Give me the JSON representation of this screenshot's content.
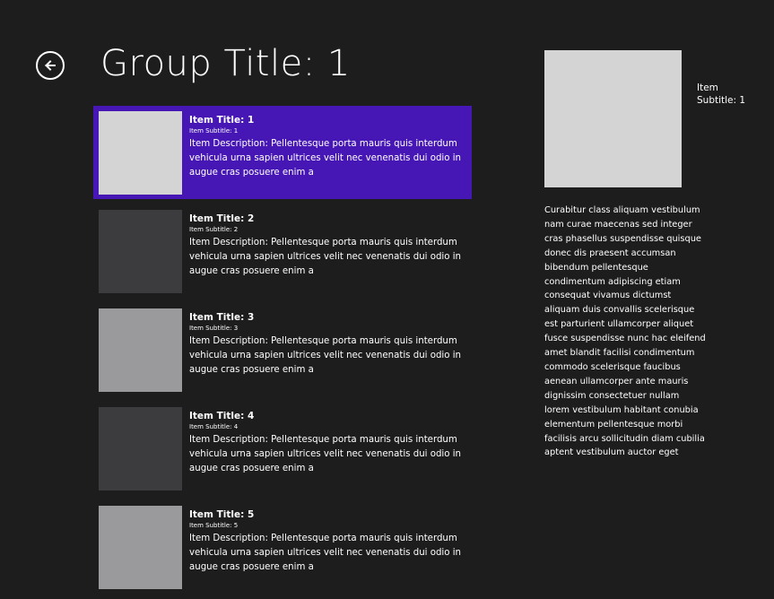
{
  "header": {
    "title": "Group Title: 1"
  },
  "items": [
    {
      "title": "Item Title: 1",
      "subtitle": "Item Subtitle: 1",
      "description": "Item Description: Pellentesque porta mauris quis interdum vehicula urna sapien ultrices velit nec venenatis dui odio in augue cras posuere enim a",
      "selected": true,
      "thumb_color": "#d4d4d4"
    },
    {
      "title": "Item Title: 2",
      "subtitle": "Item Subtitle: 2",
      "description": "Item Description: Pellentesque porta mauris quis interdum vehicula urna sapien ultrices velit nec venenatis dui odio in augue cras posuere enim a",
      "selected": false,
      "thumb_color": "#3c3c3e"
    },
    {
      "title": "Item Title: 3",
      "subtitle": "Item Subtitle: 3",
      "description": "Item Description: Pellentesque porta mauris quis interdum vehicula urna sapien ultrices velit nec venenatis dui odio in augue cras posuere enim a",
      "selected": false,
      "thumb_color": "#9a9a9c"
    },
    {
      "title": "Item Title: 4",
      "subtitle": "Item Subtitle: 4",
      "description": "Item Description: Pellentesque porta mauris quis interdum vehicula urna sapien ultrices velit nec venenatis dui odio in augue cras posuere enim a",
      "selected": false,
      "thumb_color": "#3c3c3e"
    },
    {
      "title": "Item Title: 5",
      "subtitle": "Item Subtitle: 5",
      "description": "Item Description: Pellentesque porta mauris quis interdum vehicula urna sapien ultrices velit nec venenatis dui odio in augue cras posuere enim a",
      "selected": false,
      "thumb_color": "#9a9a9c"
    }
  ],
  "detail": {
    "subtitle": "Item Subtitle: 1",
    "content": "Curabitur class aliquam vestibulum nam curae maecenas sed integer cras phasellus suspendisse quisque donec dis praesent accumsan bibendum pellentesque condimentum adipiscing etiam consequat vivamus dictumst aliquam duis convallis scelerisque est parturient ullamcorper aliquet fusce suspendisse nunc hac eleifend amet blandit facilisi condimentum commodo scelerisque faucibus aenean ullamcorper ante mauris dignissim consectetuer nullam lorem vestibulum habitant conubia elementum pellentesque morbi facilisis arcu sollicitudin diam cubilia aptent vestibulum auctor eget",
    "image_color": "#d4d4d4"
  },
  "colors": {
    "background": "#1d1d1d",
    "selection": "#4617b4",
    "text": "#ffffff"
  },
  "icons": {
    "back": "arrow-left-circle-icon"
  }
}
